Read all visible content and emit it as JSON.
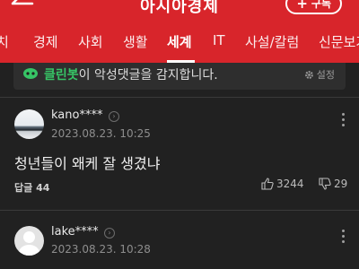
{
  "header": {
    "title": "아시아경제",
    "subscribe_label": "구독",
    "subscribe_icon": "plus-icon",
    "back_icon": "arrow-left-icon",
    "brand_color": "#d8252b"
  },
  "categories": [
    {
      "label": "치",
      "active": false
    },
    {
      "label": "경제",
      "active": false
    },
    {
      "label": "사회",
      "active": false
    },
    {
      "label": "생활",
      "active": false
    },
    {
      "label": "세계",
      "active": true
    },
    {
      "label": "IT",
      "active": false
    },
    {
      "label": "사설/칼럼",
      "active": false
    },
    {
      "label": "신문보기",
      "active": false
    }
  ],
  "notice": {
    "bot_name": "클린봇",
    "text": "이 악성댓글을 감지합니다.",
    "settings_label": "설정",
    "settings_icon": "gear-icon",
    "bot_color": "#37c566"
  },
  "comments": [
    {
      "username": "kano****",
      "date": "2023.08.23. 10:25",
      "text": "청년들이 왜케 잘 생겼냐",
      "reply_label": "답글",
      "reply_count": "44",
      "likes": "3244",
      "dislikes": "29",
      "avatar": "photo"
    },
    {
      "username": "lake****",
      "date": "2023.08.23. 10:28",
      "avatar": "default"
    }
  ]
}
